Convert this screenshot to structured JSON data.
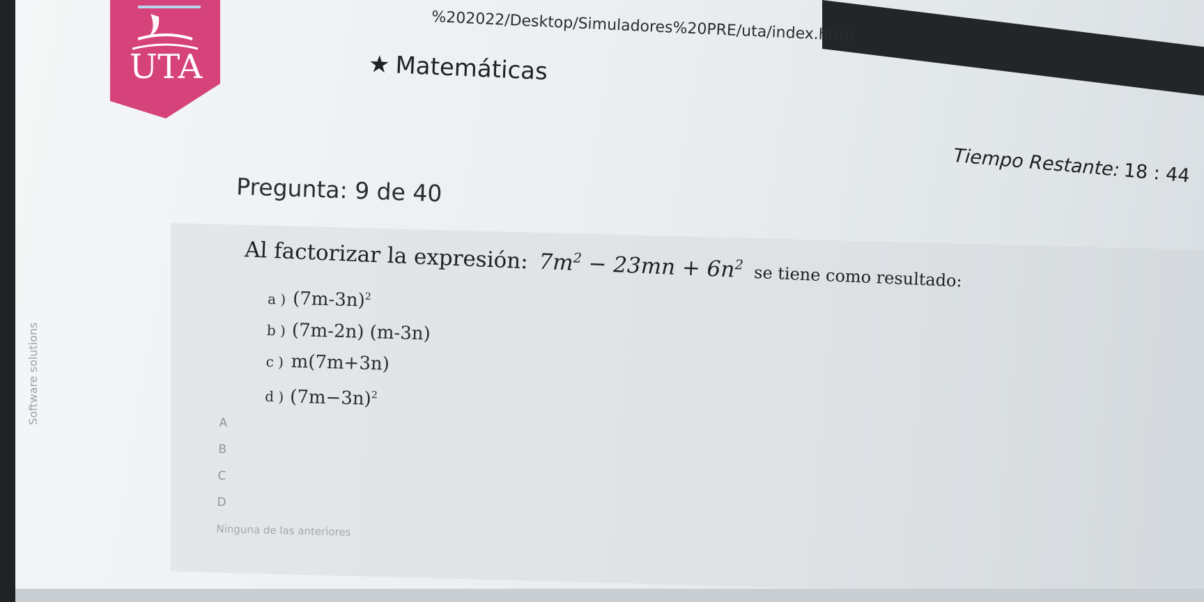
{
  "browser": {
    "url": "%202022/Desktop/Simuladores%20PRE/uta/index.html"
  },
  "logo": {
    "text": "UTA",
    "color": "#d6427a"
  },
  "header": {
    "star": "★",
    "title": "Matemáticas"
  },
  "timer": {
    "label": "Tiempo Restante:",
    "value": "18 : 44"
  },
  "question": {
    "counter": "Pregunta: 9 de 40",
    "prompt": "Al factorizar la expresión:",
    "expression": {
      "a": "7m",
      "e1": "2",
      "b": " − 23mn + 6n",
      "e2": "2"
    },
    "tail": "se tiene como resultado:",
    "options": [
      {
        "label": "a )",
        "text": "(7m-3n)",
        "sup": "2"
      },
      {
        "label": "b )",
        "text": "(7m-2n) (m-3n)",
        "sup": ""
      },
      {
        "label": "c )",
        "text": "m(7m+3n)",
        "sup": ""
      },
      {
        "label": "d )",
        "text": "(7m−3n)",
        "sup": "2"
      }
    ],
    "choices": [
      "A",
      "B",
      "C",
      "D",
      "Ninguna de las anteriores"
    ]
  },
  "side_label": "Software solutions"
}
